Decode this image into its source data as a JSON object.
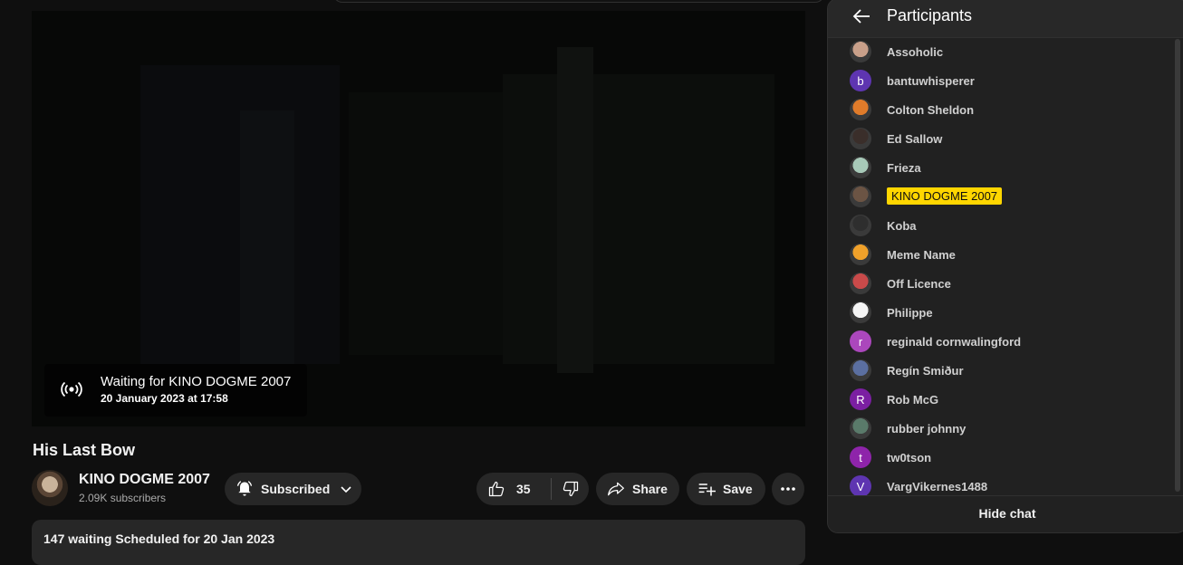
{
  "player": {
    "waiting_title": "Waiting for KINO DOGME 2007",
    "waiting_date": "20 January 2023 at 17:58"
  },
  "video": {
    "title": "His Last Bow",
    "channel_name": "KINO DOGME 2007",
    "subscribers": "2.09K subscribers",
    "subscribe_label": "Subscribed",
    "likes": "35",
    "share_label": "Share",
    "save_label": "Save",
    "description": "147 waiting  Scheduled for 20 Jan 2023"
  },
  "chat": {
    "header_title": "Participants",
    "hide_chat_label": "Hide chat",
    "participants": [
      {
        "name": "Assoholic",
        "avatar": "photo",
        "color": "#c9a08a"
      },
      {
        "name": "bantuwhisperer",
        "avatar": "b",
        "color": "#5e35b1"
      },
      {
        "name": "Colton Sheldon",
        "avatar": "photo",
        "color": "#e07b2a"
      },
      {
        "name": "Ed Sallow",
        "avatar": "photo",
        "color": "#3a2e2a"
      },
      {
        "name": "Frieza",
        "avatar": "photo",
        "color": "#a7c9b8"
      },
      {
        "name": "KINO DOGME 2007",
        "avatar": "photo",
        "color": "#6b5444",
        "owner": true
      },
      {
        "name": "Koba",
        "avatar": "photo",
        "color": "#2e2e2e"
      },
      {
        "name": "Meme Name",
        "avatar": "photo",
        "color": "#f0a12a"
      },
      {
        "name": "Off Licence",
        "avatar": "photo",
        "color": "#c94a4a"
      },
      {
        "name": "Philippe",
        "avatar": "photo",
        "color": "#f5f5f5"
      },
      {
        "name": "reginald cornwalingford",
        "avatar": "r",
        "color": "#ab47bc"
      },
      {
        "name": "Regín Smiður",
        "avatar": "photo",
        "color": "#5b6fa0"
      },
      {
        "name": "Rob McG",
        "avatar": "R",
        "color": "#7b1fa2"
      },
      {
        "name": "rubber johnny",
        "avatar": "photo",
        "color": "#5a7a6a"
      },
      {
        "name": "tw0tson",
        "avatar": "t",
        "color": "#8e24aa"
      },
      {
        "name": "VargVikernes1488",
        "avatar": "V",
        "color": "#5e35b1"
      }
    ]
  }
}
